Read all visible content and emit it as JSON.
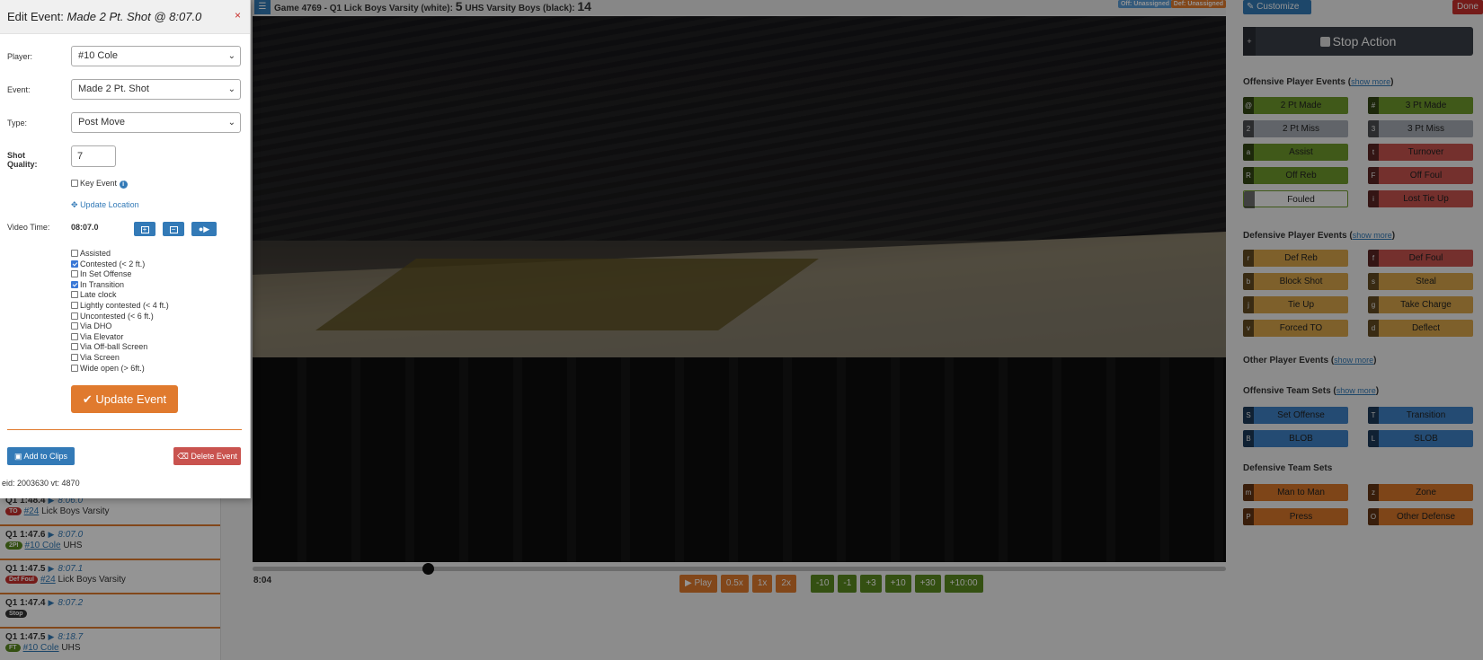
{
  "event_list": [
    {
      "time": "Q1 1:48.4",
      "vt": "8:06.0",
      "badge": "TO",
      "badge_color": "red",
      "player": "#24",
      "team": "Lick Boys Varsity"
    },
    {
      "time": "Q1 1:47.6",
      "vt": "8:07.0",
      "badge": "2PI",
      "badge_color": "green",
      "player": "#10 Cole",
      "team": "UHS"
    },
    {
      "time": "Q1 1:47.5",
      "vt": "8:07.1",
      "badge": "Def Foul",
      "badge_color": "red",
      "player": "#24",
      "team": "Lick Boys Varsity"
    },
    {
      "time": "Q1 1:47.4",
      "vt": "8:07.2",
      "badge": "Stop",
      "badge_color": "dark",
      "player": "",
      "team": ""
    },
    {
      "time": "Q1 1:47.5",
      "vt": "8:18.7",
      "badge": "FT",
      "badge_color": "green",
      "player": "#10 Cole",
      "team": "UHS"
    }
  ],
  "header": {
    "game_text": "Game 4769 - Q1 Lick Boys Varsity (white):",
    "home_score": "5",
    "away_text": "UHS Varsity Boys (black):",
    "away_score": "14",
    "off_unassigned": "Off: Unassigned",
    "def_unassigned": "Def: Unassigned"
  },
  "player_controls": {
    "time": "8:04",
    "progress_fraction": 0.18,
    "buttons": [
      "Play",
      "0.5x",
      "1x",
      "2x"
    ],
    "skip_buttons": [
      "-10",
      "-1",
      "+3",
      "+10",
      "+30",
      "+10:00"
    ]
  },
  "right_panel": {
    "customize": "Customize",
    "done": "Done",
    "stop_key": "+",
    "stop_label": "Stop Action",
    "show_more": "show more",
    "sections": {
      "offensive_player": "Offensive Player Events",
      "defensive_player": "Defensive Player Events",
      "other_player": "Other Player Events",
      "offensive_team": "Offensive Team Sets",
      "defensive_team": "Defensive Team Sets"
    },
    "offensive_buttons": [
      {
        "key": "@",
        "label": "2 Pt Made",
        "color": "green"
      },
      {
        "key": "#",
        "label": "3 Pt Made",
        "color": "green"
      },
      {
        "key": "2",
        "label": "2 Pt Miss",
        "color": "gray"
      },
      {
        "key": "3",
        "label": "3 Pt Miss",
        "color": "gray"
      },
      {
        "key": "a",
        "label": "Assist",
        "color": "green"
      },
      {
        "key": "t",
        "label": "Turnover",
        "color": "red"
      },
      {
        "key": "R",
        "label": "Off Reb",
        "color": "green"
      },
      {
        "key": "F",
        "label": "Off Foul",
        "color": "red"
      },
      {
        "key": "",
        "label": "Fouled",
        "color": "outline"
      },
      {
        "key": "i",
        "label": "Lost Tie Up",
        "color": "red"
      }
    ],
    "defensive_buttons": [
      {
        "key": "r",
        "label": "Def Reb",
        "color": "tan"
      },
      {
        "key": "f",
        "label": "Def Foul",
        "color": "red"
      },
      {
        "key": "b",
        "label": "Block Shot",
        "color": "tan"
      },
      {
        "key": "s",
        "label": "Steal",
        "color": "tan"
      },
      {
        "key": "j",
        "label": "Tie Up",
        "color": "tan"
      },
      {
        "key": "g",
        "label": "Take Charge",
        "color": "tan"
      },
      {
        "key": "v",
        "label": "Forced TO",
        "color": "tan"
      },
      {
        "key": "d",
        "label": "Deflect",
        "color": "tan"
      }
    ],
    "off_team_buttons": [
      {
        "key": "S",
        "label": "Set Offense",
        "color": "blue"
      },
      {
        "key": "T",
        "label": "Transition",
        "color": "blue"
      },
      {
        "key": "B",
        "label": "BLOB",
        "color": "blue"
      },
      {
        "key": "L",
        "label": "SLOB",
        "color": "blue"
      }
    ],
    "def_team_buttons": [
      {
        "key": "m",
        "label": "Man to Man",
        "color": "orange"
      },
      {
        "key": "z",
        "label": "Zone",
        "color": "orange"
      },
      {
        "key": "P",
        "label": "Press",
        "color": "orange"
      },
      {
        "key": "O",
        "label": "Other Defense",
        "color": "orange"
      }
    ]
  },
  "modal": {
    "title_prefix": "Edit Event:",
    "title_event": "Made 2 Pt. Shot @ 8:07.0",
    "close": "×",
    "player_label": "Player:",
    "player_value": "#10 Cole",
    "event_label": "Event:",
    "event_value": "Made 2 Pt. Shot",
    "type_label": "Type:",
    "type_value": "Post Move",
    "shot_quality_label_1": "Shot",
    "shot_quality_label_2": "Quality:",
    "shot_quality_value": "7",
    "key_event": "Key Event",
    "update_location": "Update Location",
    "video_time_label": "Video Time:",
    "video_time_value": "08:07.0",
    "attributes": [
      {
        "label": "Assisted",
        "checked": false
      },
      {
        "label": "Contested (< 2 ft.)",
        "checked": true
      },
      {
        "label": "In Set Offense",
        "checked": false
      },
      {
        "label": "In Transition",
        "checked": true
      },
      {
        "label": "Late clock",
        "checked": false
      },
      {
        "label": "Lightly contested (< 4 ft.)",
        "checked": false
      },
      {
        "label": "Uncontested (< 6 ft.)",
        "checked": false
      },
      {
        "label": "Via DHO",
        "checked": false
      },
      {
        "label": "Via Elevator",
        "checked": false
      },
      {
        "label": "Via Off-ball Screen",
        "checked": false
      },
      {
        "label": "Via Screen",
        "checked": false
      },
      {
        "label": "Wide open (> 6ft.)",
        "checked": false
      }
    ],
    "update_button": "Update Event",
    "add_clips": "Add to Clips",
    "delete_event": "Delete Event",
    "eid_text": "eid: 2003630 vt: 4870"
  }
}
